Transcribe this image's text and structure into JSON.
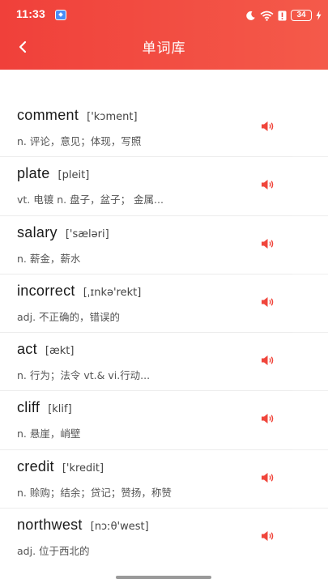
{
  "status_bar": {
    "time": "11:33",
    "battery": "34"
  },
  "nav": {
    "title": "单词库",
    "back_icon": "chevron-left-icon"
  },
  "colors": {
    "header_start": "#f0403a",
    "header_end": "#f45a4a",
    "speaker": "#f0453b"
  },
  "words": [
    {
      "word": "comment",
      "phonetic": "['kɔment]",
      "meaning": "n. 评论，意见；体现，写照"
    },
    {
      "word": "plate",
      "phonetic": "[pleit]",
      "meaning": "vt. 电镀  n. 盘子，盆子； 金属..."
    },
    {
      "word": "salary",
      "phonetic": "['sæləri]",
      "meaning": "n. 薪金，薪水"
    },
    {
      "word": "incorrect",
      "phonetic": "[ˌɪnkə'rekt]",
      "meaning": "adj. 不正确的，错误的"
    },
    {
      "word": "act",
      "phonetic": "[ækt]",
      "meaning": "n. 行为；法令  vt.& vi.行动..."
    },
    {
      "word": "cliff",
      "phonetic": "[klif]",
      "meaning": "n. 悬崖，峭壁"
    },
    {
      "word": "credit",
      "phonetic": "['kredit]",
      "meaning": "n. 赊购；结余；贷记；赞扬，称赞"
    },
    {
      "word": "northwest",
      "phonetic": "[nɔːθ'west]",
      "meaning": "adj. 位于西北的"
    }
  ],
  "speaker_icon": "speaker-icon"
}
